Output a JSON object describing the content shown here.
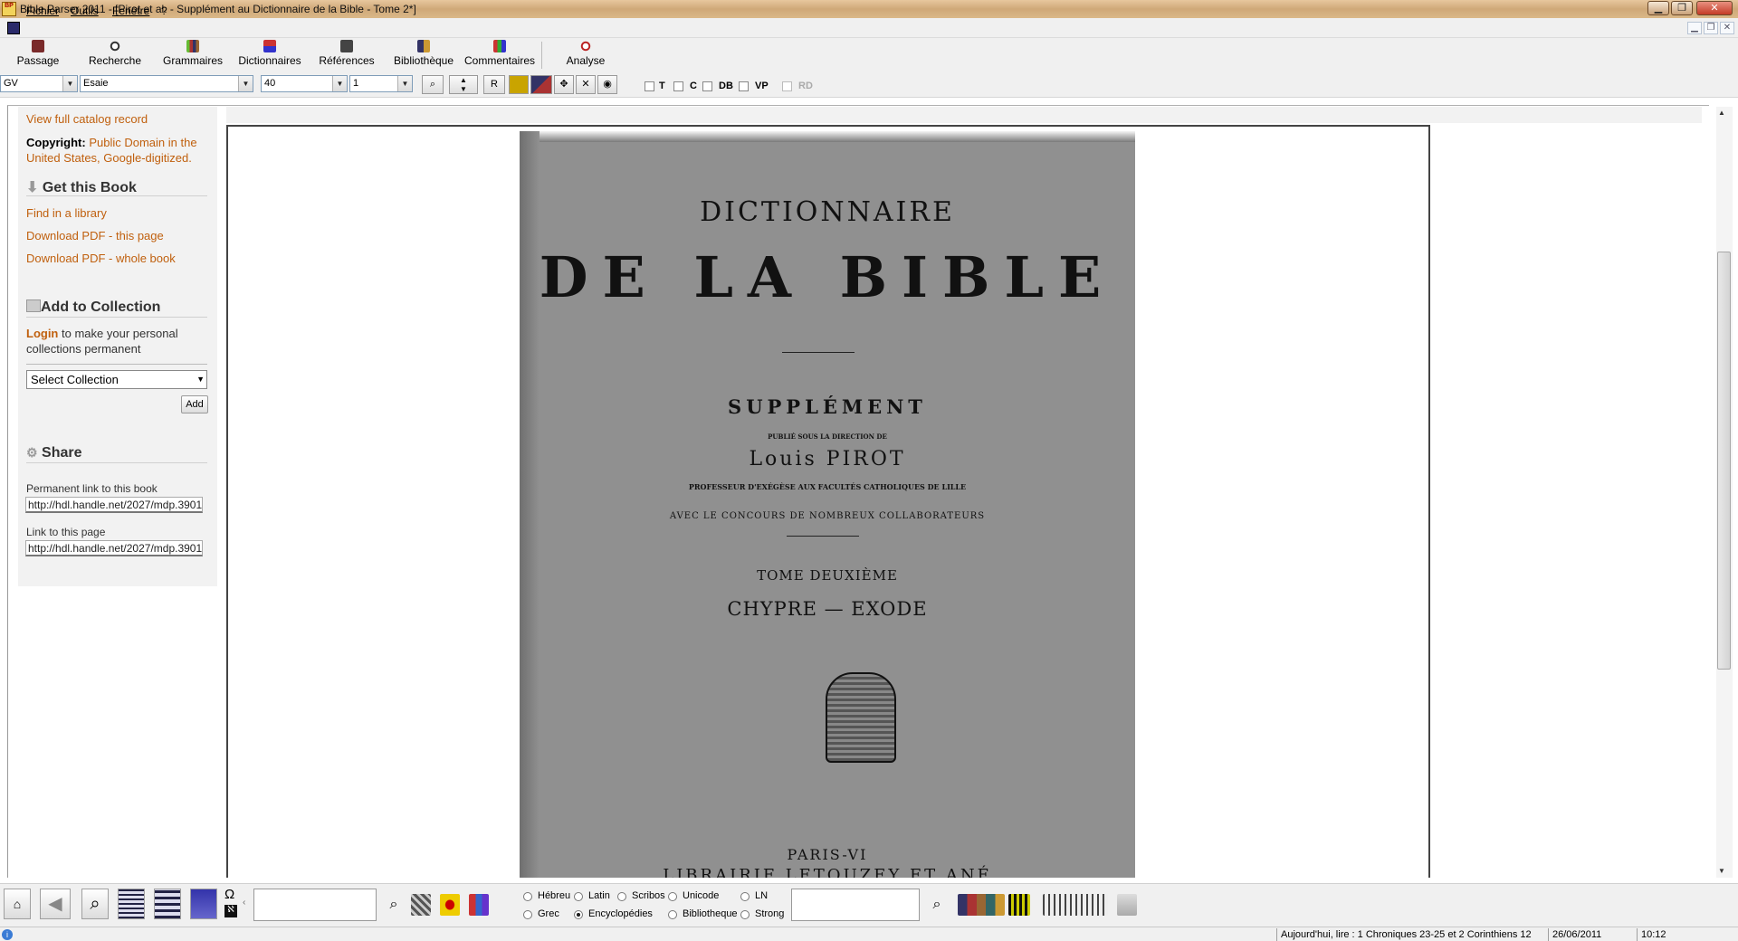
{
  "window": {
    "title": "Bible Parser 2011 - [Pirot et al. - Supplément au Dictionnaire de la Bible - Tome 2*]",
    "app_icon": "BP"
  },
  "menu": {
    "items": [
      "Fichier",
      "Outils",
      "Fenêtre",
      "?"
    ]
  },
  "toolbar": {
    "buttons": [
      {
        "label": "Passage",
        "icon": "book-icon"
      },
      {
        "label": "Recherche",
        "icon": "search-icon"
      },
      {
        "label": "Grammaires",
        "icon": "books-icon"
      },
      {
        "label": "Dictionnaires",
        "icon": "dictionary-icon"
      },
      {
        "label": "Références",
        "icon": "references-icon"
      },
      {
        "label": "Bibliothèque",
        "icon": "library-icon"
      },
      {
        "label": "Commentaires",
        "icon": "commentary-icon"
      },
      {
        "label": "Analyse",
        "icon": "analysis-icon"
      }
    ]
  },
  "nav": {
    "version": "GV",
    "book": "Esaie",
    "chapter": "40",
    "verse": "1",
    "r_button": "R",
    "checkboxes": [
      "T",
      "C",
      "DB",
      "VP",
      "RD"
    ]
  },
  "sidebar": {
    "catalog_link": "View full catalog record",
    "copyright_label": "Copyright:",
    "copyright_value": "Public Domain in the United States, Google-digitized.",
    "get_book_heading": "Get this Book",
    "find_library": "Find in a library",
    "download_page": "Download PDF - this page",
    "download_book": "Download PDF - whole book",
    "collection_heading": "Add to Collection",
    "login_link": "Login",
    "login_text": "to make your personal collections permanent",
    "select_collection": "Select Collection",
    "add_button": "Add",
    "share_heading": "Share",
    "permanent_link_label": "Permanent link to this book",
    "permanent_link_value": "http://hdl.handle.net/2027/mdp.3901",
    "page_link_label": "Link to this page",
    "page_link_value": "http://hdl.handle.net/2027/mdp.3901"
  },
  "scan": {
    "line1": "DICTIONNAIRE",
    "line2": "DE LA BIBLE",
    "line3": "SUPPLÉMENT",
    "line4": "PUBLIÉ SOUS LA DIRECTION DE",
    "line5": "Louis PIROT",
    "line6": "PROFESSEUR D'EXÉGÈSE AUX FACULTÉS CATHOLIQUES DE LILLE",
    "line7": "AVEC LE CONCOURS DE NOMBREUX COLLABORATEURS",
    "line8": "TOME DEUXIÈME",
    "line9": "CHYPRE — EXODE",
    "line10": "PARIS-VI",
    "line11": "LIBRAIRIE LETOUZEY ET ANÉ"
  },
  "bottom": {
    "search_value": "",
    "search2_value": "",
    "radios": [
      {
        "label": "Hébreu",
        "checked": false
      },
      {
        "label": "Latin",
        "checked": false
      },
      {
        "label": "Scribos",
        "checked": false
      },
      {
        "label": "Unicode",
        "checked": false
      },
      {
        "label": "LN",
        "checked": false
      },
      {
        "label": "Grec",
        "checked": false
      },
      {
        "label": "Encyclopédies",
        "checked": true
      },
      {
        "label": "Bibliotheque",
        "checked": false
      },
      {
        "label": "Strong",
        "checked": false
      }
    ],
    "omega": "Ω"
  },
  "status": {
    "reading": "Aujourd'hui, lire : 1 Chroniques 23-25 et 2 Corinthiens 12",
    "date": "26/06/2011",
    "time": "10:12"
  },
  "colors": {
    "link": "#c0600e",
    "title_bar": "#d8b484",
    "scan_paper": "#909090"
  }
}
